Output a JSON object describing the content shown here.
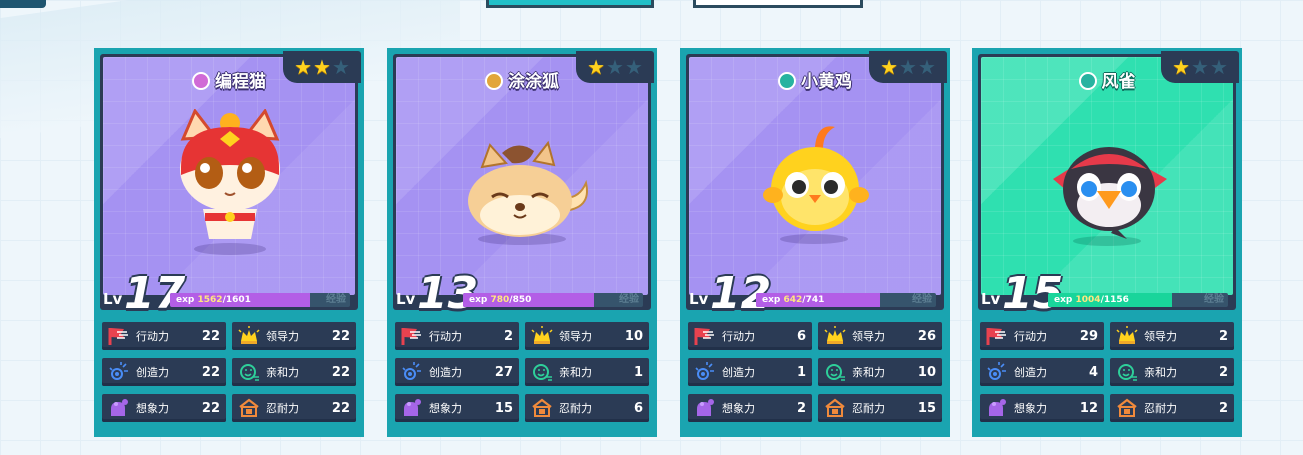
{
  "cards": [
    {
      "name": "编程猫",
      "type_icon": "pink",
      "theme": "purple",
      "stars_on": 2,
      "stars_total": 3,
      "level_label": "Lv",
      "level": "17",
      "exp_label": "exp",
      "exp_current": "1562",
      "exp_total": "/1601",
      "exp_ratio": 0.976,
      "exp_tag": "经验",
      "creature": "cat",
      "stats": [
        {
          "name": "行动力",
          "value": "22",
          "icon": "flag-run-icon"
        },
        {
          "name": "领导力",
          "value": "22",
          "icon": "crown-icon"
        },
        {
          "name": "创造力",
          "value": "22",
          "icon": "idea-icon"
        },
        {
          "name": "亲和力",
          "value": "22",
          "icon": "smile-icon"
        },
        {
          "name": "想象力",
          "value": "22",
          "icon": "thought-icon"
        },
        {
          "name": "忍耐力",
          "value": "22",
          "icon": "endurance-icon"
        }
      ]
    },
    {
      "name": "涂涂狐",
      "type_icon": "gold",
      "theme": "purple",
      "stars_on": 1,
      "stars_total": 3,
      "level_label": "Lv",
      "level": "13",
      "exp_label": "exp",
      "exp_current": "780",
      "exp_total": "/850",
      "exp_ratio": 0.918,
      "exp_tag": "经验",
      "creature": "fox",
      "stats": [
        {
          "name": "行动力",
          "value": "2",
          "icon": "flag-run-icon"
        },
        {
          "name": "领导力",
          "value": "10",
          "icon": "crown-icon"
        },
        {
          "name": "创造力",
          "value": "27",
          "icon": "idea-icon"
        },
        {
          "name": "亲和力",
          "value": "1",
          "icon": "smile-icon"
        },
        {
          "name": "想象力",
          "value": "15",
          "icon": "thought-icon"
        },
        {
          "name": "忍耐力",
          "value": "6",
          "icon": "endurance-icon"
        }
      ]
    },
    {
      "name": "小黄鸡",
      "type_icon": "teal",
      "theme": "purple",
      "stars_on": 1,
      "stars_total": 3,
      "level_label": "Lv",
      "level": "12",
      "exp_label": "exp",
      "exp_current": "642",
      "exp_total": "/741",
      "exp_ratio": 0.866,
      "exp_tag": "经验",
      "creature": "chick",
      "stats": [
        {
          "name": "行动力",
          "value": "6",
          "icon": "flag-run-icon"
        },
        {
          "name": "领导力",
          "value": "26",
          "icon": "crown-icon"
        },
        {
          "name": "创造力",
          "value": "1",
          "icon": "idea-icon"
        },
        {
          "name": "亲和力",
          "value": "10",
          "icon": "smile-icon"
        },
        {
          "name": "想象力",
          "value": "2",
          "icon": "thought-icon"
        },
        {
          "name": "忍耐力",
          "value": "15",
          "icon": "endurance-icon"
        }
      ]
    },
    {
      "name": "风雀",
      "type_icon": "teal",
      "theme": "green",
      "stars_on": 1,
      "stars_total": 3,
      "level_label": "Lv",
      "level": "15",
      "exp_label": "exp",
      "exp_current": "1004",
      "exp_total": "/1156",
      "exp_ratio": 0.868,
      "exp_tag": "经验",
      "creature": "bird",
      "stats": [
        {
          "name": "行动力",
          "value": "29",
          "icon": "flag-run-icon"
        },
        {
          "name": "领导力",
          "value": "2",
          "icon": "crown-icon"
        },
        {
          "name": "创造力",
          "value": "4",
          "icon": "idea-icon"
        },
        {
          "name": "亲和力",
          "value": "2",
          "icon": "smile-icon"
        },
        {
          "name": "想象力",
          "value": "12",
          "icon": "thought-icon"
        },
        {
          "name": "忍耐力",
          "value": "2",
          "icon": "endurance-icon"
        }
      ]
    }
  ],
  "colors": {
    "card_border": "#1aa4b0",
    "frame": "#2b3b55",
    "art_purple": "#a592f2",
    "art_green": "#2fe0b0",
    "exp_purple": "#b35ee6",
    "exp_green": "#19d59b",
    "star_on": "#ffd21e",
    "tab_active": "#21c0c8"
  }
}
